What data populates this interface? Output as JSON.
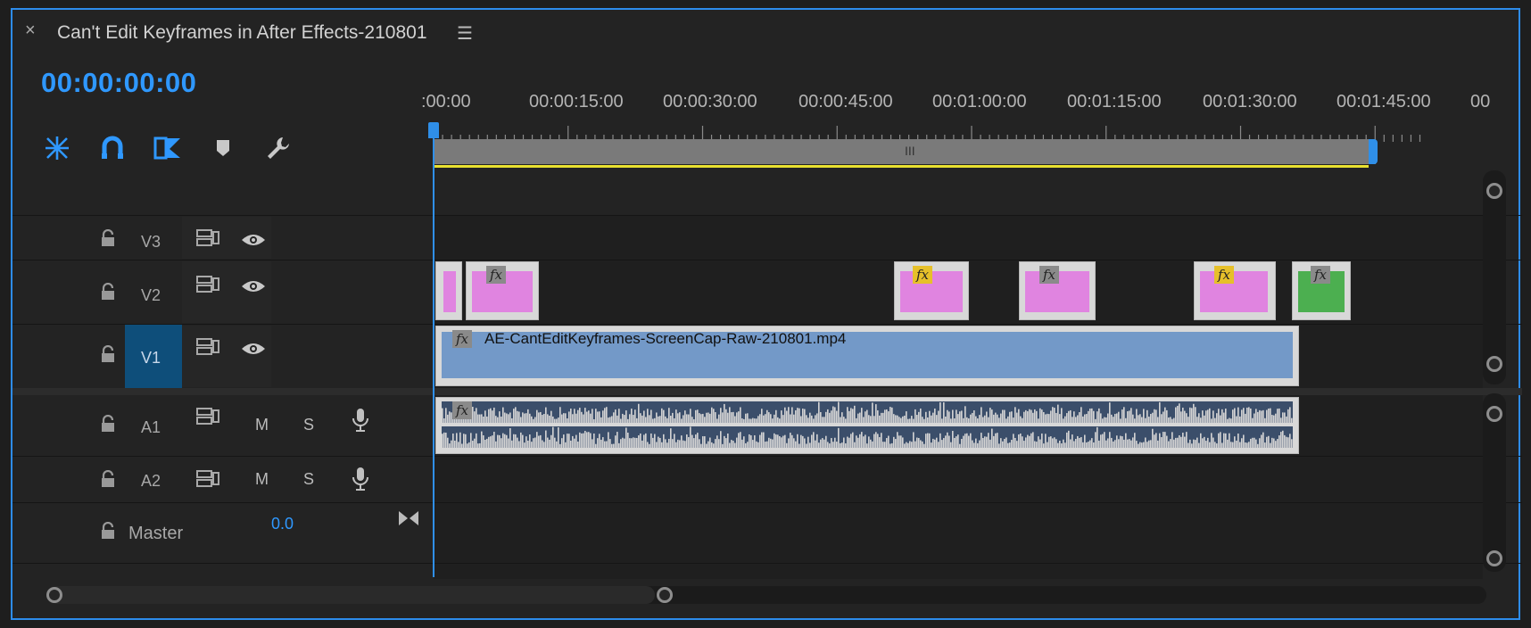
{
  "window": {
    "title": "Can't Edit Keyframes in After Effects-210801",
    "close_glyph": "×",
    "menu_glyph": "☰"
  },
  "timecode": "00:00:00:00",
  "toolbar": {
    "icons": [
      "insert-and-overwrite-sequences-icon",
      "snap-magnet-icon",
      "linked-selection-icon",
      "add-marker-icon",
      "timeline-settings-wrench-icon"
    ]
  },
  "ruler": {
    "labels": [
      ":00:00",
      "00:00:15:00",
      "00:00:30:00",
      "00:00:45:00",
      "00:01:00:00",
      "00:01:15:00",
      "00:01:30:00",
      "00:01:45:00",
      "00"
    ]
  },
  "zoombar": {
    "grip_glyph": "III"
  },
  "tracks": {
    "v3": {
      "label": "V3"
    },
    "v2": {
      "label": "V2"
    },
    "v1": {
      "label": "V1",
      "selected": true
    },
    "a1": {
      "label": "A1",
      "mute": "M",
      "solo": "S"
    },
    "a2": {
      "label": "A2",
      "mute": "M",
      "solo": "S"
    },
    "master": {
      "label": "Master",
      "value": "0.0"
    }
  },
  "clips": {
    "v1_name": "AE-CantEditKeyframes-ScreenCap-Raw-210801.mp4",
    "fx_label": "fx"
  },
  "colors": {
    "accent": "#2f98ff",
    "v2_clip_pink": "#e084e0",
    "v2_clip_green": "#4caf50",
    "v1_clip_blue": "#7399c8",
    "audio_clip": "#3b4e6a",
    "work_area_yellow": "#e8e030"
  }
}
